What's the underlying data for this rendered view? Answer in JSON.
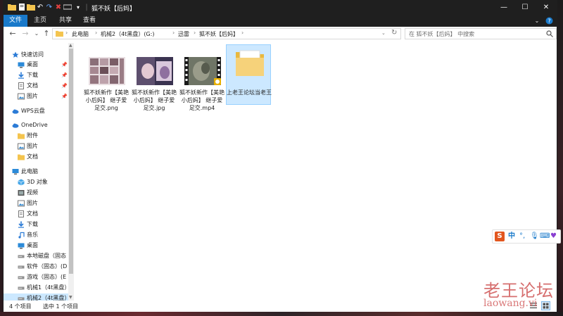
{
  "window": {
    "title": "狐不妖【后妈】",
    "controls": {
      "minimize": "—",
      "maximize": "☐",
      "close": "✕"
    }
  },
  "ribbon": {
    "tabs": [
      "文件",
      "主页",
      "共享",
      "查看"
    ]
  },
  "address": {
    "crumbs": [
      "此电脑",
      "机械2（4t黑盘）(G:)",
      "迅雷",
      "狐不妖【后妈】"
    ]
  },
  "search": {
    "placeholder": "在 狐不妖【后妈】 中搜索"
  },
  "nav": {
    "items": [
      {
        "label": "快速访问",
        "icon": "star-icon"
      },
      {
        "label": "桌面",
        "icon": "desktop-icon",
        "pinned": true
      },
      {
        "label": "下载",
        "icon": "download-icon",
        "pinned": true
      },
      {
        "label": "文档",
        "icon": "documents-icon",
        "pinned": true
      },
      {
        "label": "图片",
        "icon": "pictures-icon",
        "pinned": true
      },
      {
        "label": "WPS云盘",
        "icon": "cloud-icon"
      },
      {
        "label": "OneDrive",
        "icon": "cloud-icon"
      },
      {
        "label": "附件",
        "icon": "folder-icon"
      },
      {
        "label": "图片",
        "icon": "pictures-icon"
      },
      {
        "label": "文档",
        "icon": "folder-icon"
      },
      {
        "label": "此电脑",
        "icon": "computer-icon"
      },
      {
        "label": "3D 对象",
        "icon": "cube-icon"
      },
      {
        "label": "视频",
        "icon": "video-icon"
      },
      {
        "label": "图片",
        "icon": "pictures-icon"
      },
      {
        "label": "文档",
        "icon": "documents-icon"
      },
      {
        "label": "下载",
        "icon": "download-icon"
      },
      {
        "label": "音乐",
        "icon": "music-icon"
      },
      {
        "label": "桌面",
        "icon": "desktop-icon"
      },
      {
        "label": "本地磁盘（固态",
        "icon": "drive-icon"
      },
      {
        "label": "软件（固态）(D",
        "icon": "drive-icon"
      },
      {
        "label": "游戏（固态）(E",
        "icon": "drive-icon"
      },
      {
        "label": "机械1（4t黑盘）",
        "icon": "drive-icon"
      },
      {
        "label": "机械2（4t黑盘）",
        "icon": "drive-icon"
      }
    ]
  },
  "files": [
    {
      "name": "狐不妖新作【美艳小后妈】 继子爱足交.png",
      "type": "image"
    },
    {
      "name": "狐不妖新作【美艳小后妈】 继子爱足交.jpg",
      "type": "image"
    },
    {
      "name": "狐不妖新作【美艳小后妈】 继子爱足交.mp4",
      "type": "video"
    },
    {
      "name": "上老王论坛当老王",
      "type": "folder"
    }
  ],
  "status": {
    "count": "4 个项目",
    "selection": "选中 1 个项目"
  },
  "ime": {
    "logo": "S",
    "mode": "中"
  },
  "watermark": {
    "cn": "老王论坛",
    "en": "laowang.vi"
  },
  "colors": {
    "accent": "#1979ca",
    "selection": "#cce8ff",
    "titlebar": "#1f1f1f"
  }
}
